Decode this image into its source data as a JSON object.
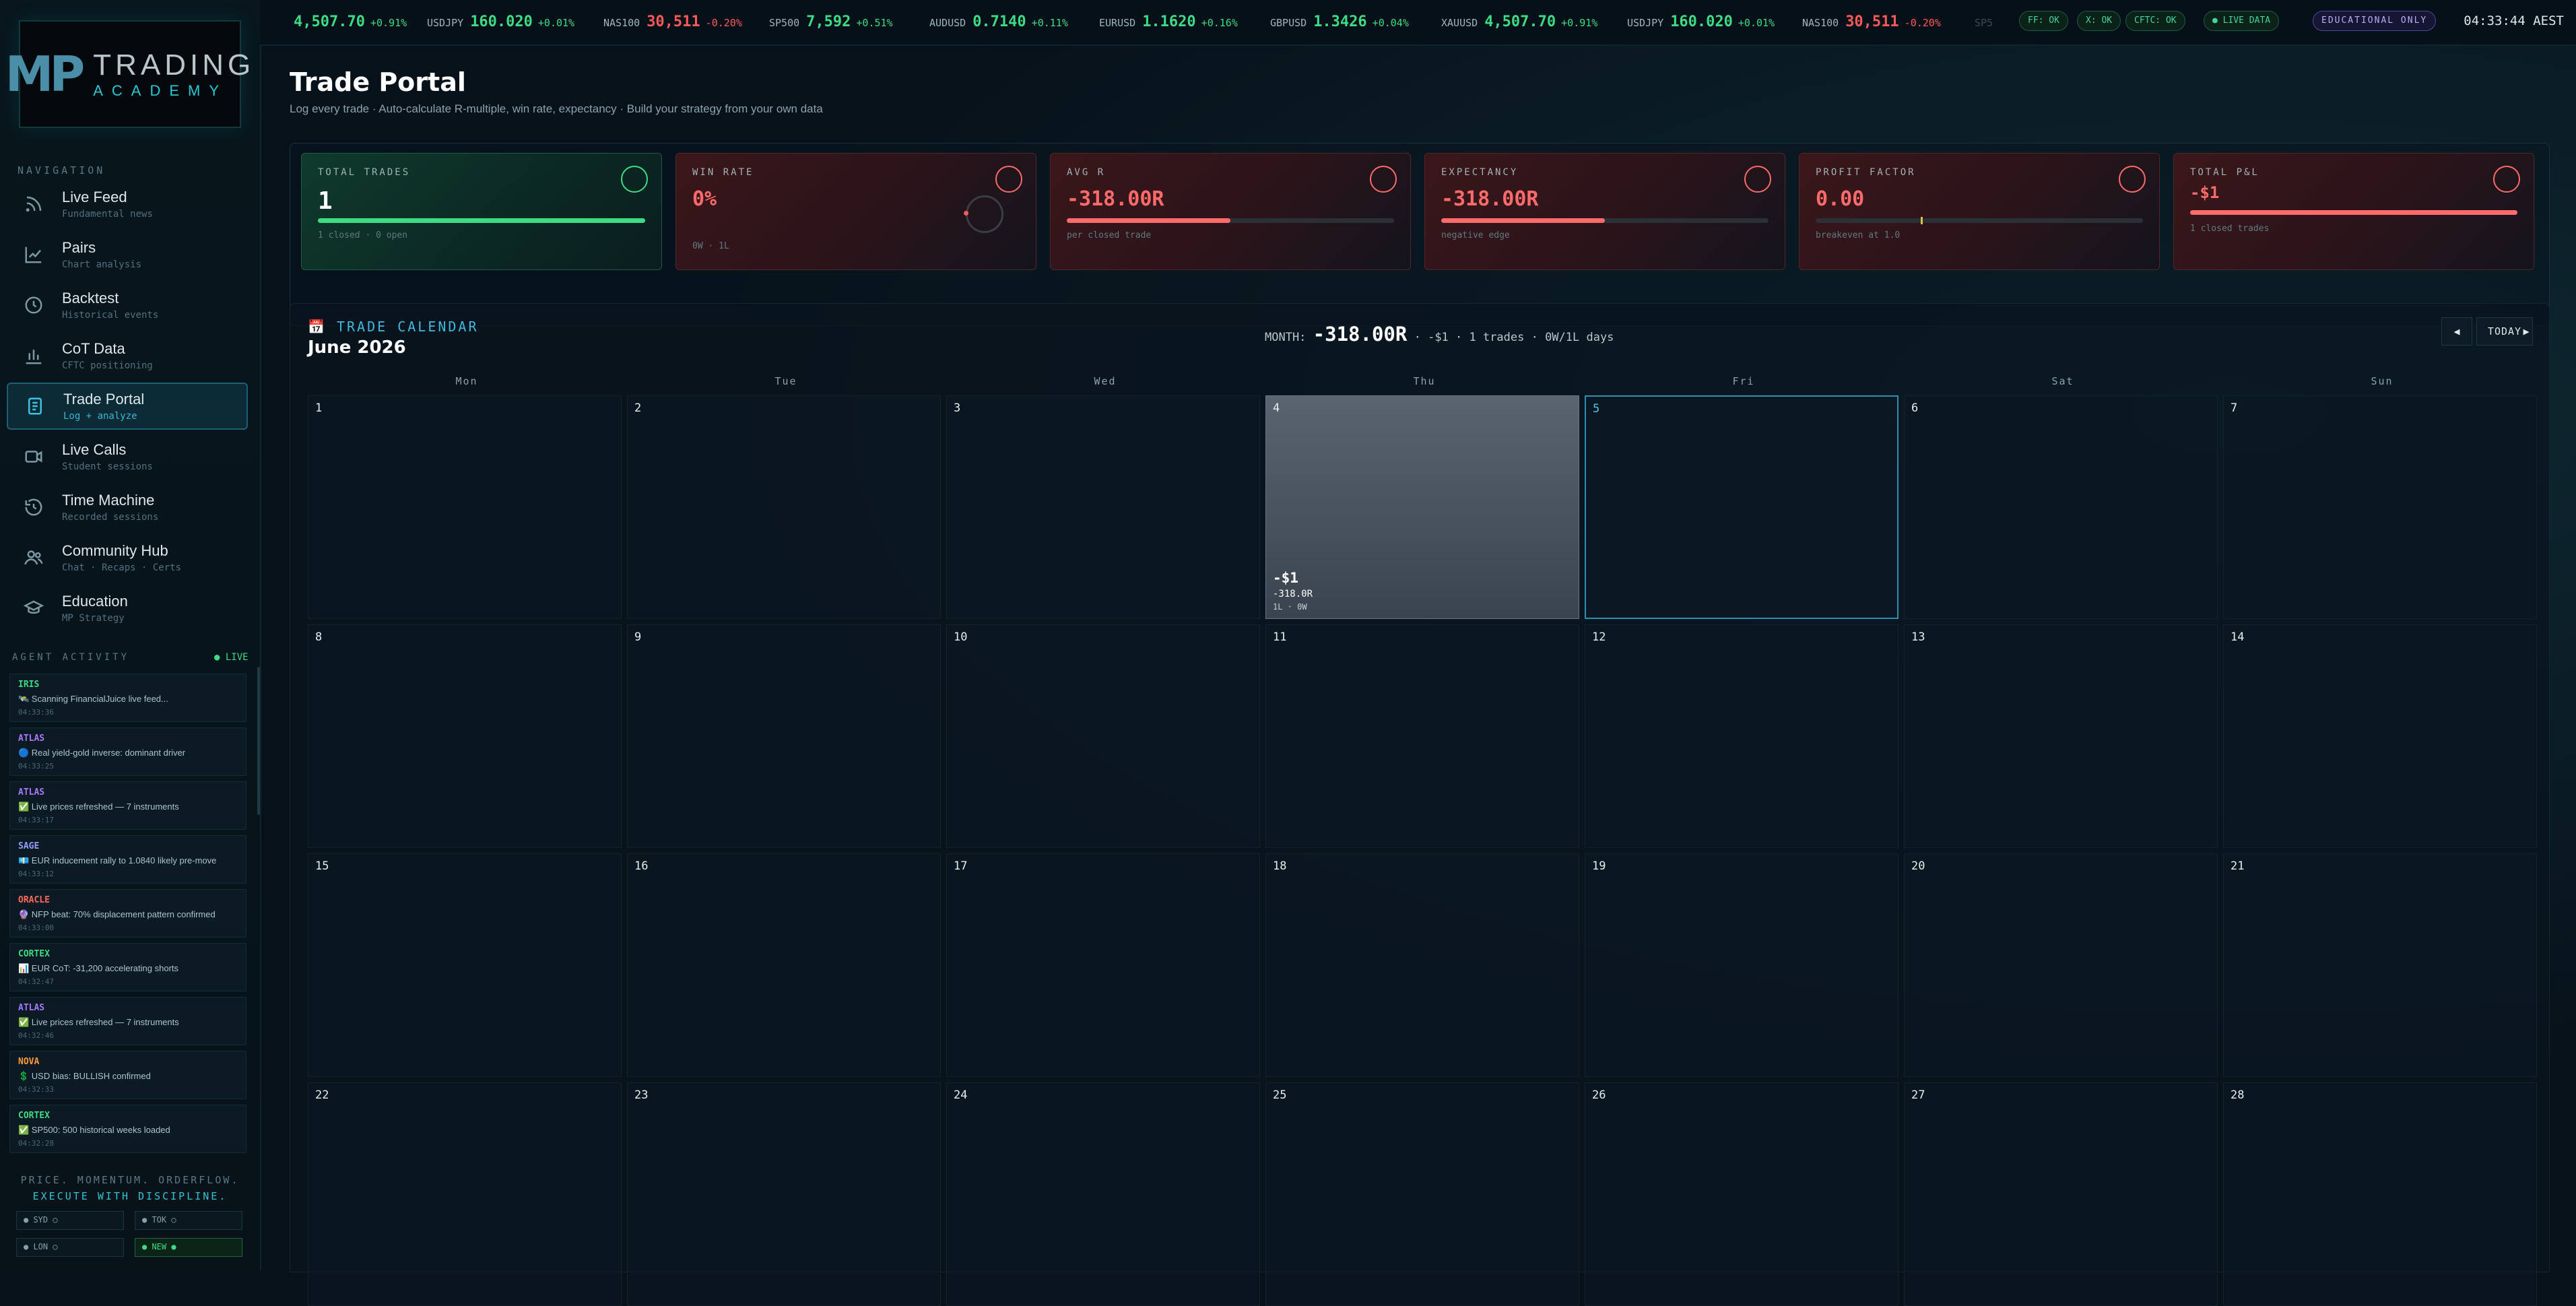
{
  "ticker": {
    "items": [
      {
        "symbol": "",
        "price": "4,507.70",
        "change": "+0.91%",
        "dir": "up"
      },
      {
        "symbol": "USDJPY",
        "price": "160.020",
        "change": "+0.01%",
        "dir": "up"
      },
      {
        "symbol": "NAS100",
        "price": "30,511",
        "change": "-0.20%",
        "dir": "down"
      },
      {
        "symbol": "SP500",
        "price": "7,592",
        "change": "+0.51%",
        "dir": "up"
      },
      {
        "symbol": "AUDUSD",
        "price": "0.7140",
        "change": "+0.11%",
        "dir": "up"
      },
      {
        "symbol": "EURUSD",
        "price": "1.1620",
        "change": "+0.16%",
        "dir": "up"
      },
      {
        "symbol": "GBPUSD",
        "price": "1.3426",
        "change": "+0.04%",
        "dir": "up"
      },
      {
        "symbol": "XAUUSD",
        "price": "4,507.70",
        "change": "+0.91%",
        "dir": "up"
      },
      {
        "symbol": "USDJPY",
        "price": "160.020",
        "change": "+0.01%",
        "dir": "up"
      },
      {
        "symbol": "NAS100",
        "price": "30,511",
        "change": "-0.20%",
        "dir": "down"
      },
      {
        "symbol": "SP5",
        "price": "",
        "change": "",
        "dir": "up"
      }
    ],
    "status_pills": [
      "FF: OK",
      "X: OK",
      "CFTC: OK"
    ],
    "live_pill": "● LIVE DATA",
    "edu_pill": "EDUCATIONAL ONLY",
    "clock": "04:33:44 AEST"
  },
  "logo": {
    "mark": "MP",
    "line1": "TRADING",
    "line2": "ACADEMY"
  },
  "sidebar": {
    "nav_heading": "NAVIGATION",
    "items": [
      {
        "label": "Live Feed",
        "sub": "Fundamental news",
        "icon": "rss-icon"
      },
      {
        "label": "Pairs",
        "sub": "Chart analysis",
        "icon": "chart-line-icon"
      },
      {
        "label": "Backtest",
        "sub": "Historical events",
        "icon": "clock-icon"
      },
      {
        "label": "CoT Data",
        "sub": "CFTC positioning",
        "icon": "bar-chart-icon"
      },
      {
        "label": "Trade Portal",
        "sub": "Log + analyze",
        "icon": "document-icon"
      },
      {
        "label": "Live Calls",
        "sub": "Student sessions",
        "icon": "video-icon"
      },
      {
        "label": "Time Machine",
        "sub": "Recorded sessions",
        "icon": "history-icon"
      },
      {
        "label": "Community Hub",
        "sub": "Chat · Recaps · Certs",
        "icon": "users-icon"
      },
      {
        "label": "Education",
        "sub": "MP Strategy",
        "icon": "graduation-cap-icon"
      }
    ],
    "agent_heading": "AGENT ACTIVITY",
    "agent_live": "● LIVE",
    "agents": [
      {
        "name": "IRIS",
        "color": "#3ddc84",
        "msg": "🛰️ Scanning FinancialJuice live feed...",
        "time": "04:33:36"
      },
      {
        "name": "ATLAS",
        "color": "#a778ff",
        "msg": "🔵 Real yield-gold inverse: dominant driver",
        "time": "04:33:25"
      },
      {
        "name": "ATLAS",
        "color": "#a778ff",
        "msg": "✅ Live prices refreshed — 7 instruments",
        "time": "04:33:17"
      },
      {
        "name": "SAGE",
        "color": "#9a9cff",
        "msg": "💶 EUR inducement rally to 1.0840 likely pre-move",
        "time": "04:33:12"
      },
      {
        "name": "ORACLE",
        "color": "#ff6a5a",
        "msg": "🔮 NFP beat: 70% displacement pattern confirmed",
        "time": "04:33:00"
      },
      {
        "name": "CORTEX",
        "color": "#3ddc84",
        "msg": "📊 EUR CoT: -31,200 accelerating shorts",
        "time": "04:32:47"
      },
      {
        "name": "ATLAS",
        "color": "#a778ff",
        "msg": "✅ Live prices refreshed — 7 instruments",
        "time": "04:32:46"
      },
      {
        "name": "NOVA",
        "color": "#ff9a3c",
        "msg": "💲 USD bias: BULLISH confirmed",
        "time": "04:32:33"
      },
      {
        "name": "CORTEX",
        "color": "#3ddc84",
        "msg": "✅ SP500: 500 historical weeks loaded",
        "time": "04:32:28"
      }
    ],
    "tagline1": "PRICE. MOMENTUM. ORDERFLOW.",
    "tagline2": "EXECUTE WITH DISCIPLINE.",
    "sessions": [
      "● SYD ○",
      "● TOK ○",
      "● LON ○",
      "● NEW ●"
    ]
  },
  "page": {
    "title": "Trade Portal",
    "subtitle": "Log every trade · Auto-calculate R-multiple, win rate, expectancy · Build your strategy from your own data"
  },
  "stats": [
    {
      "label": "TOTAL TRADES",
      "value": "1",
      "foot": "1 closed · 0 open",
      "theme": "green",
      "value_color": "#ffffff",
      "bar_fill": 1.0,
      "bar_color": "#3ddc84"
    },
    {
      "label": "WIN RATE",
      "value": "0%",
      "foot": "0W · 1L",
      "theme": "red",
      "value_color": "#ff6a6a",
      "bar_fill": null,
      "bar_color": "#ff6a6a"
    },
    {
      "label": "AVG R",
      "value": "-318.00R",
      "foot": "per closed trade",
      "theme": "red",
      "value_color": "#ff6a6a",
      "bar_fill": 0.5,
      "bar_color": "#ff6a6a"
    },
    {
      "label": "EXPECTANCY",
      "value": "-318.00R",
      "foot": "negative edge",
      "theme": "red",
      "value_color": "#ff6a6a",
      "bar_fill": 0.5,
      "bar_color": "#ff6a6a"
    },
    {
      "label": "PROFIT FACTOR",
      "value": "0.00",
      "foot": "breakeven at 1.0",
      "theme": "red",
      "value_color": "#ff6a6a",
      "bar_fill": 0.0,
      "bar_color": "#d8c14a"
    },
    {
      "label": "TOTAL P&L",
      "value": "-$1",
      "foot": "1 closed trades",
      "theme": "red",
      "value_color": "#ff6a6a",
      "bar_fill": 1.0,
      "bar_color": "#ff6a6a"
    }
  ],
  "calendar": {
    "badge": "📅 TRADE CALENDAR",
    "month": "June 2026",
    "summary_label": "MONTH:",
    "summary_value": "-318.00R",
    "summary_rest": "· -$1 · 1 trades · 0W/1L days",
    "prev_label": "◀",
    "today_label": "TODAY",
    "next_label": "▶",
    "weekdays": [
      "Mon",
      "Tue",
      "Wed",
      "Thu",
      "Fri",
      "Sat",
      "Sun"
    ],
    "weeks": [
      [
        "1",
        "2",
        "3",
        "4",
        "5",
        "6",
        "7"
      ],
      [
        "8",
        "9",
        "10",
        "11",
        "12",
        "13",
        "14"
      ],
      [
        "15",
        "16",
        "17",
        "18",
        "19",
        "20",
        "21"
      ],
      [
        "22",
        "23",
        "24",
        "25",
        "26",
        "27",
        "28"
      ]
    ],
    "trade_day": {
      "day": "4",
      "pl": "-$1",
      "r": "-318.0R",
      "wl": "1L · 0W"
    },
    "today": "5"
  }
}
